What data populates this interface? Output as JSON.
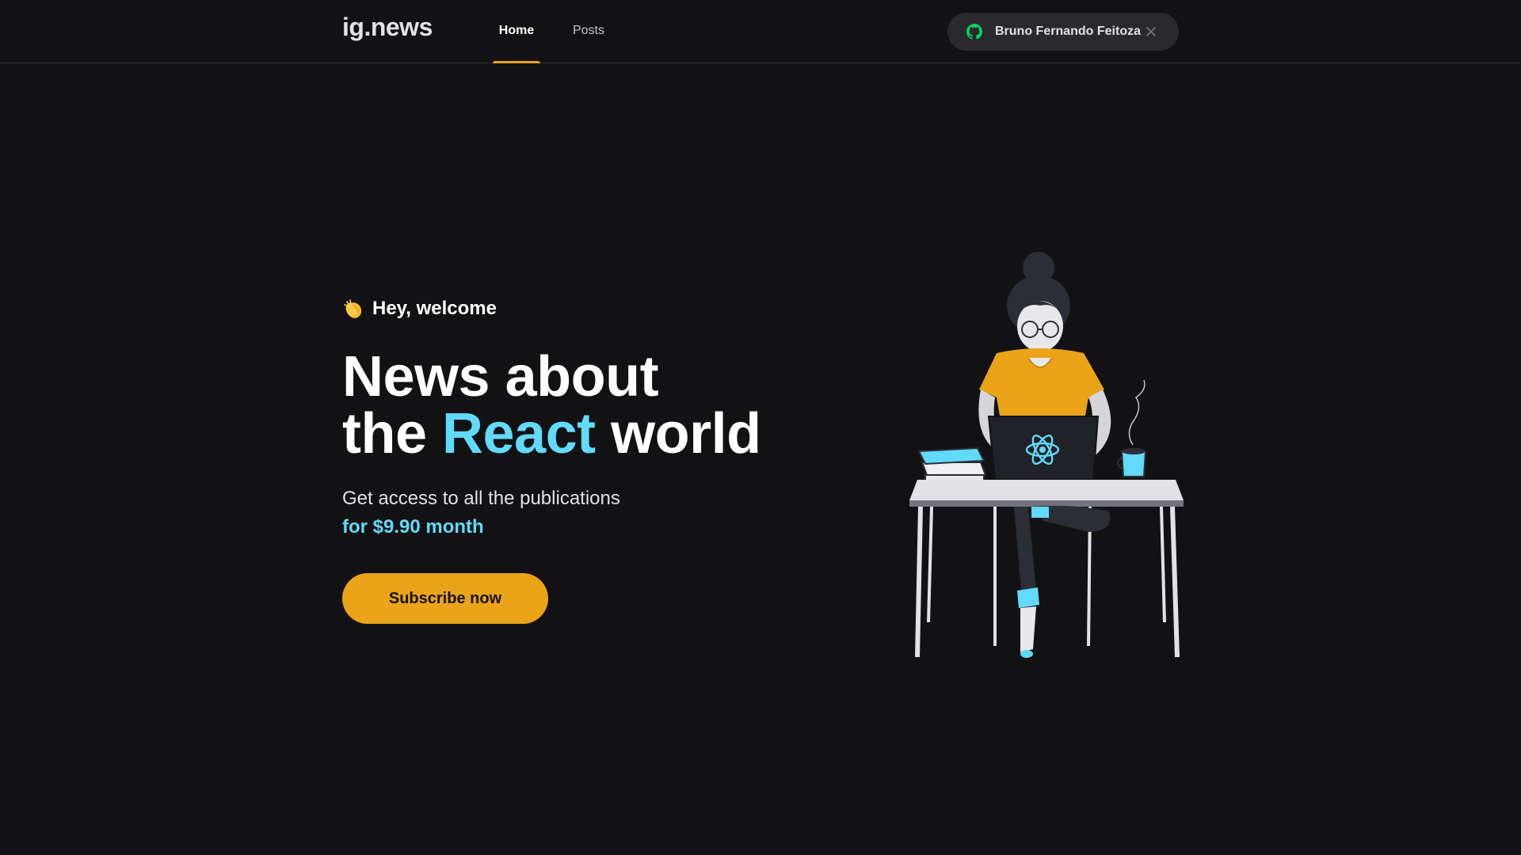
{
  "header": {
    "logo": "ig.news",
    "nav": [
      {
        "label": "Home",
        "active": true
      },
      {
        "label": "Posts",
        "active": false
      }
    ],
    "user": {
      "name": "Bruno Fernando Feitoza",
      "provider_icon": "github-icon",
      "signout_icon": "close-icon"
    }
  },
  "hero": {
    "greeting_icon": "clapping-hands-icon",
    "greeting": "Hey, welcome",
    "headline_line1": "News about",
    "headline_pre": "the ",
    "headline_accent": "React",
    "headline_post": " world",
    "subtitle": "Get access to all the publications",
    "price": "for $9.90 month",
    "cta_label": "Subscribe now"
  },
  "colors": {
    "background": "#121214",
    "accent_yellow": "#eba417",
    "accent_cyan": "#61dafb",
    "github_green": "#04d361",
    "pill_bg": "#29292e"
  }
}
